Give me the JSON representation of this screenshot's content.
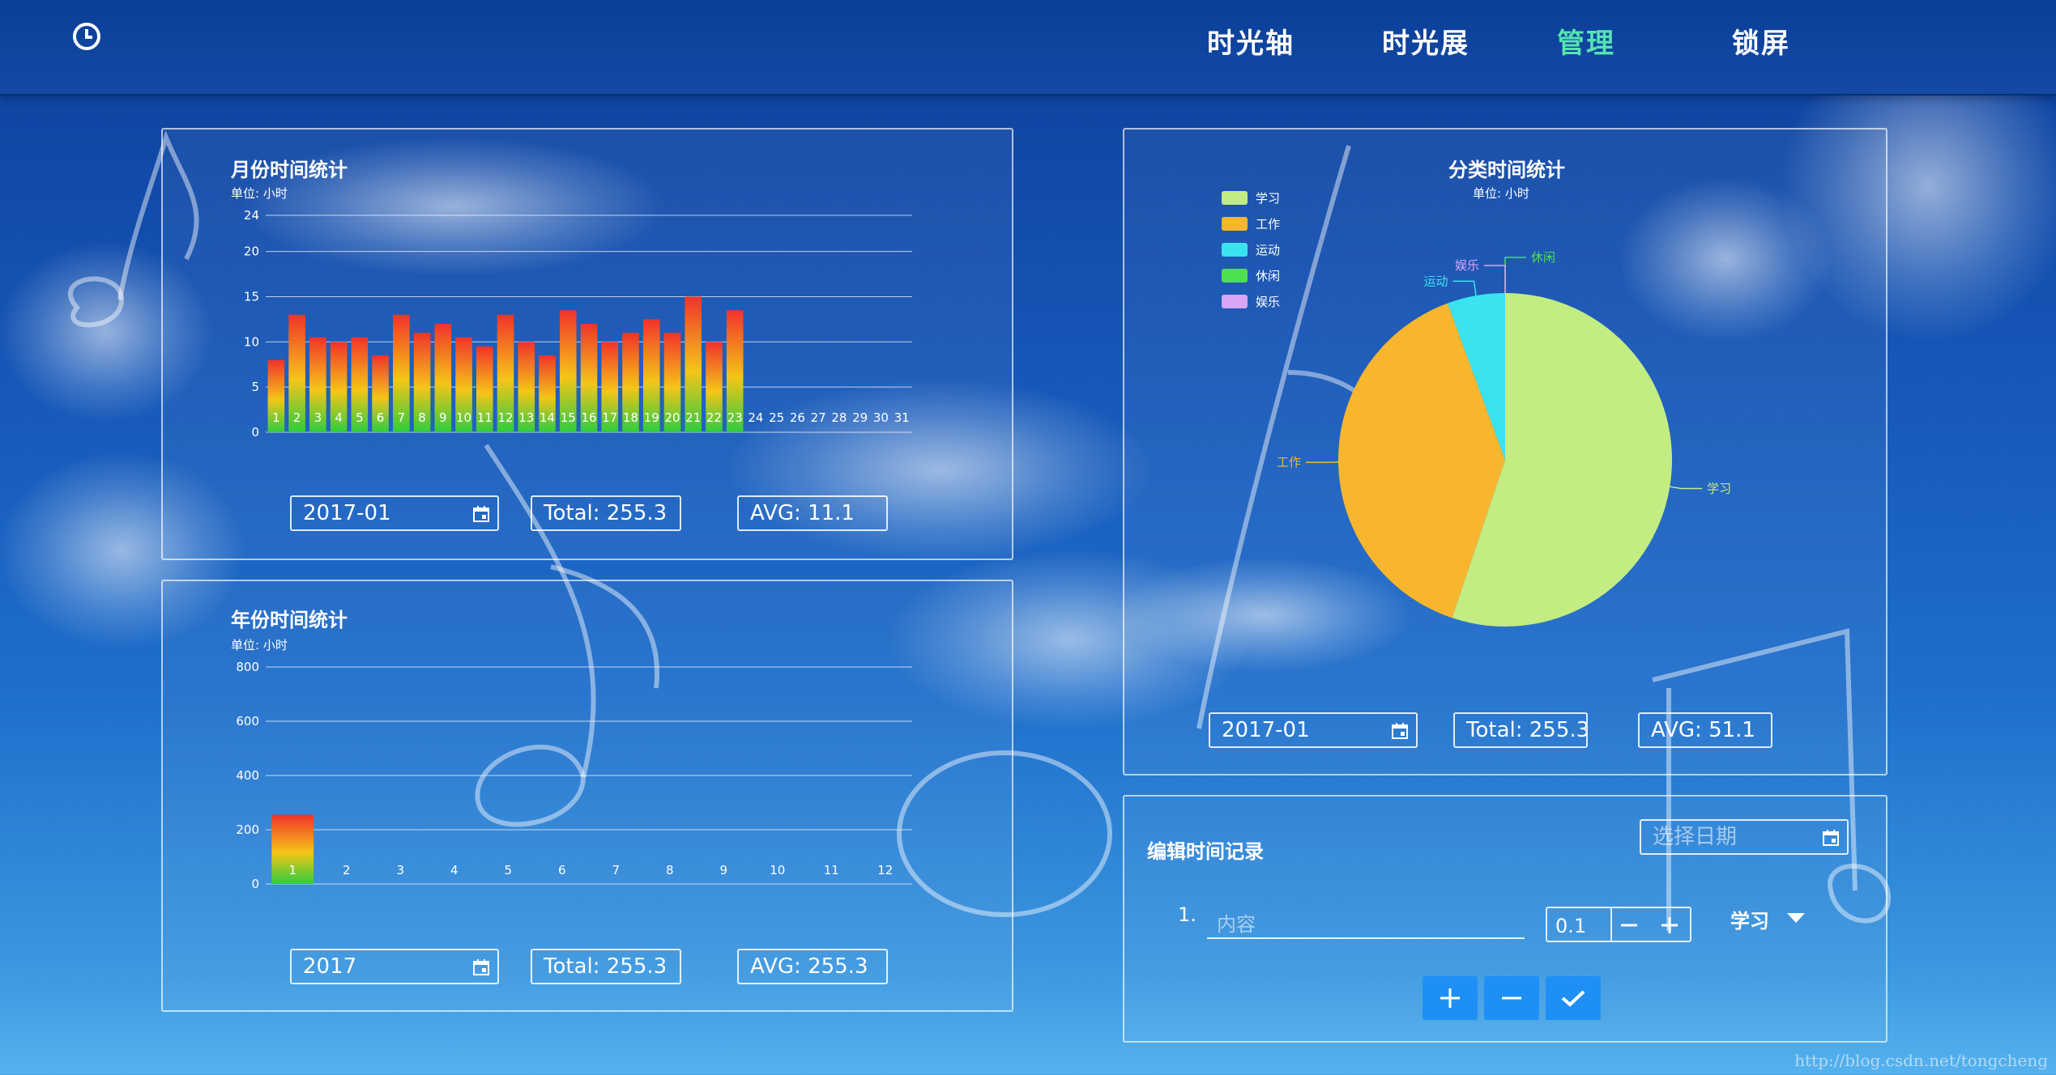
{
  "nav": {
    "items": [
      {
        "label": "时光轴"
      },
      {
        "label": "时光展"
      },
      {
        "label": "管理"
      },
      {
        "label": "锁屏"
      }
    ],
    "active_color": "#56e3b2"
  },
  "monthly": {
    "title": "月份时间统计",
    "unit": "单位: 小时",
    "date": "2017-01",
    "total": "Total: 255.3",
    "avg": "AVG: 11.1"
  },
  "yearly": {
    "title": "年份时间统计",
    "unit": "单位: 小时",
    "date": "2017",
    "total": "Total: 255.3",
    "avg": "AVG: 255.3"
  },
  "category": {
    "title": "分类时间统计",
    "unit": "单位: 小时",
    "date": "2017-01",
    "total": "Total: 255.3",
    "avg": "AVG: 51.1"
  },
  "edit": {
    "title": "编辑时间记录",
    "date_placeholder": "选择日期",
    "row_index": "1.",
    "content_placeholder": "内容",
    "hours_value": "0.1",
    "category_value": "学习",
    "add_button_color": "#1e90f5"
  },
  "watermark": "http://blog.csdn.net/tongcheng",
  "chart_data": [
    {
      "type": "bar",
      "title": "月份时间统计",
      "ylabel": "单位: 小时",
      "categories": [
        "1",
        "2",
        "3",
        "4",
        "5",
        "6",
        "7",
        "8",
        "9",
        "10",
        "11",
        "12",
        "13",
        "14",
        "15",
        "16",
        "17",
        "18",
        "19",
        "20",
        "21",
        "22",
        "23",
        "24",
        "25",
        "26",
        "27",
        "28",
        "29",
        "30",
        "31"
      ],
      "values": [
        8,
        13,
        10.5,
        10,
        10.5,
        8.5,
        13,
        11,
        12,
        10.5,
        9.5,
        13,
        10,
        8.5,
        13.5,
        12,
        10,
        11,
        12.5,
        11,
        15,
        10,
        13.5,
        null,
        null,
        null,
        null,
        null,
        null,
        null,
        null
      ],
      "yticks": [
        0,
        5,
        10,
        15,
        20,
        24
      ],
      "ylim": [
        0,
        24
      ],
      "gradient": [
        "#2ecc40",
        "#f5c518",
        "#f0332a"
      ]
    },
    {
      "type": "bar",
      "title": "年份时间统计",
      "ylabel": "单位: 小时",
      "categories": [
        "1",
        "2",
        "3",
        "4",
        "5",
        "6",
        "7",
        "8",
        "9",
        "10",
        "11",
        "12"
      ],
      "values": [
        255.3,
        null,
        null,
        null,
        null,
        null,
        null,
        null,
        null,
        null,
        null,
        null
      ],
      "yticks": [
        0,
        200,
        400,
        600,
        800
      ],
      "ylim": [
        0,
        800
      ]
    },
    {
      "type": "pie",
      "title": "分类时间统计",
      "unit": "单位: 小时",
      "labels": [
        "学习",
        "工作",
        "运动",
        "休闲",
        "娱乐"
      ],
      "values": [
        140.8,
        100.2,
        14.3,
        0,
        0
      ],
      "colors": [
        "#c3ec83",
        "#f7b62d",
        "#3be3f0",
        "#4fe04f",
        "#d9a6f5"
      ],
      "legend": "top-left"
    }
  ]
}
